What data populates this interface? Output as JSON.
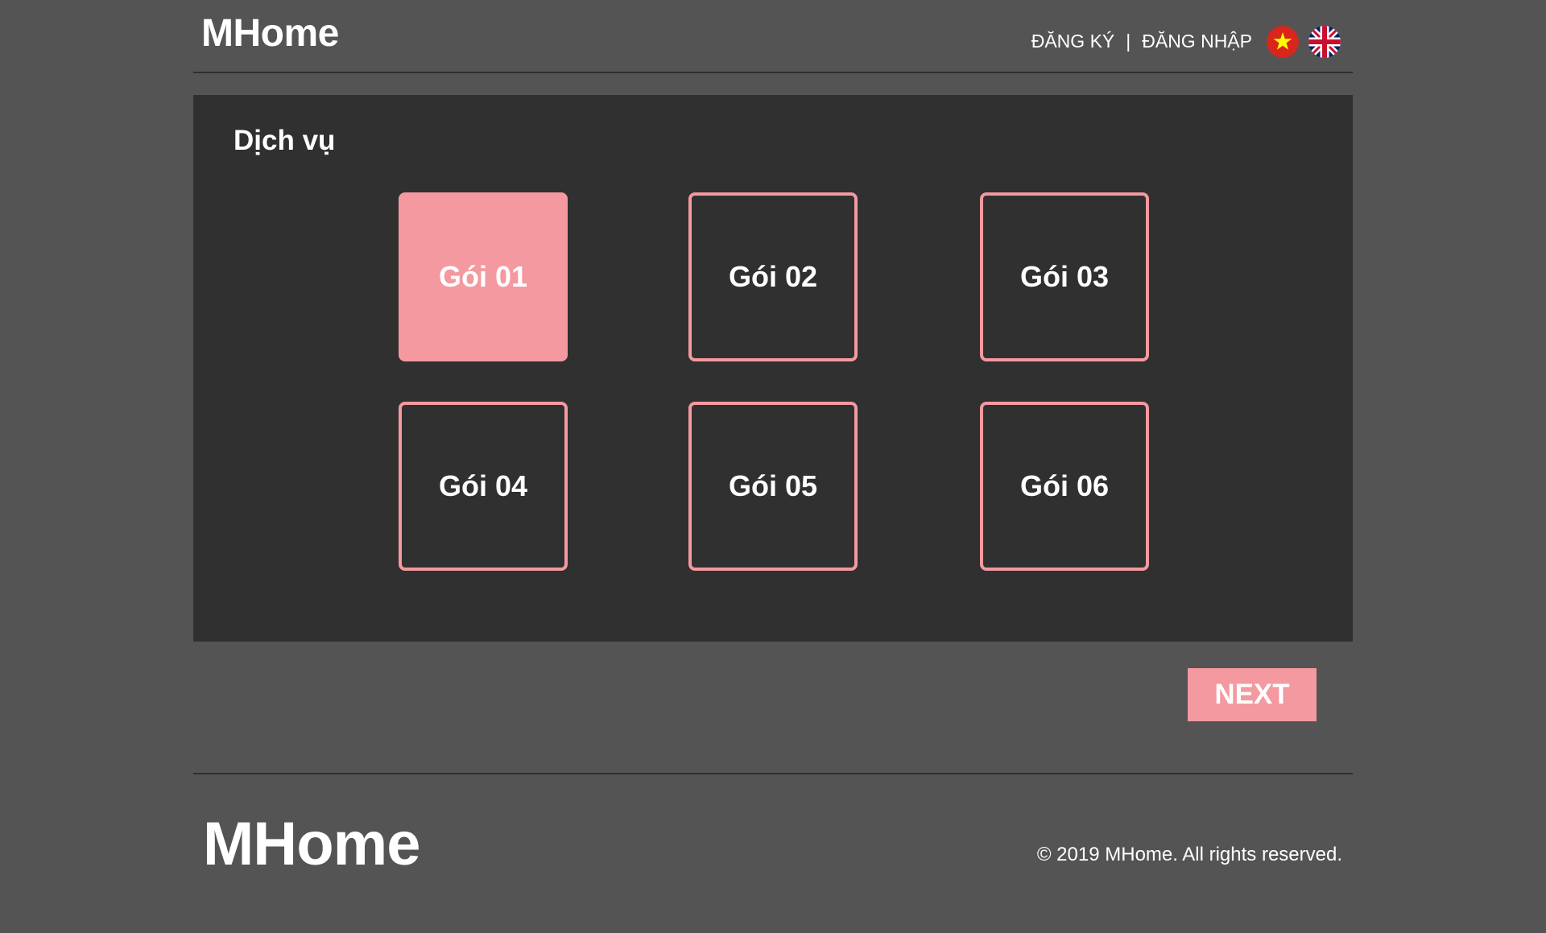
{
  "header": {
    "logo": "MHome",
    "register_label": "ĐĂNG KÝ",
    "separator": "|",
    "login_label": "ĐĂNG NHẬP",
    "flags": [
      {
        "icon": "vietnam-flag-icon",
        "language": "vi"
      },
      {
        "icon": "uk-flag-icon",
        "language": "en"
      }
    ]
  },
  "services": {
    "title": "Dịch vụ",
    "packages": [
      {
        "label": "Gói 01",
        "selected": true
      },
      {
        "label": "Gói 02",
        "selected": false
      },
      {
        "label": "Gói 03",
        "selected": false
      },
      {
        "label": "Gói 04",
        "selected": false
      },
      {
        "label": "Gói 05",
        "selected": false
      },
      {
        "label": "Gói 06",
        "selected": false
      }
    ]
  },
  "next_label": "NEXT",
  "footer": {
    "logo": "MHome",
    "copyright": "© 2019 MHome. All rights reserved."
  },
  "colors": {
    "page_background": "#545454",
    "panel_background": "#303030",
    "accent": "#f3999f",
    "text": "#ffffff"
  }
}
